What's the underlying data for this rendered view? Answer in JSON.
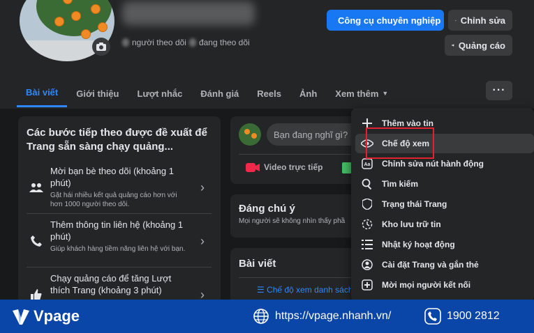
{
  "header": {
    "followers_text": "người theo dõi",
    "following_text": "đang theo dõi",
    "buttons": {
      "pro_tools": "Công cụ chuyên nghiệp",
      "edit": "Chỉnh sửa",
      "ads": "Quảng cáo"
    }
  },
  "tabs": [
    "Bài viết",
    "Giới thiệu",
    "Lượt nhắc",
    "Đánh giá",
    "Reels",
    "Ảnh",
    "Xem thêm"
  ],
  "more_button": "···",
  "left_card": {
    "title": "Các bước tiếp theo được đề xuất để Trang sẵn sàng chạy quảng...",
    "steps": [
      {
        "title": "Mời bạn bè theo dõi (khoảng 1 phút)",
        "subtitle": "Gặt hái nhiều kết quả quảng cáo hơn với hơn 1000 người theo dõi."
      },
      {
        "title": "Thêm thông tin liên hệ (khoảng 1 phút)",
        "subtitle": "Giúp khách hàng tiềm năng liên hệ với bạn."
      },
      {
        "title": "Chạy quảng cáo để tăng Lượt thích Trang (khoảng 3 phút)",
        "subtitle": ""
      }
    ]
  },
  "post_card": {
    "placeholder": "Bạn đang nghĩ gì?",
    "live_label": "Video trực tiếp"
  },
  "notice_card": {
    "title": "Đáng chú ý",
    "subtitle": "Mọi người sẽ không nhìn thấy phầ"
  },
  "posts_card": {
    "title": "Bài viết",
    "view_mode_link": "Chế độ xem danh sách"
  },
  "menu": {
    "items": [
      {
        "icon": "plus-icon",
        "label": "Thêm vào tin"
      },
      {
        "icon": "eye-icon",
        "label": "Chế độ xem"
      },
      {
        "icon": "action-button-icon",
        "label": "Chỉnh sửa nút hành động"
      },
      {
        "icon": "search-icon",
        "label": "Tìm kiếm"
      },
      {
        "icon": "shield-icon",
        "label": "Trạng thái Trang"
      },
      {
        "icon": "archive-icon",
        "label": "Kho lưu trữ tin"
      },
      {
        "icon": "list-icon",
        "label": "Nhật ký hoạt động"
      },
      {
        "icon": "settings-person-icon",
        "label": "Cài đặt Trang và gắn thẻ"
      },
      {
        "icon": "connect-icon",
        "label": "Mời mọi người kết nối"
      }
    ]
  },
  "footer": {
    "brand": "Vpage",
    "website": "https://vpage.nhanh.vn/",
    "phone": "1900 2812"
  },
  "colors": {
    "accent": "#1877f2",
    "highlight_box": "#e0232f",
    "footer_bg": "#0a46a8"
  }
}
